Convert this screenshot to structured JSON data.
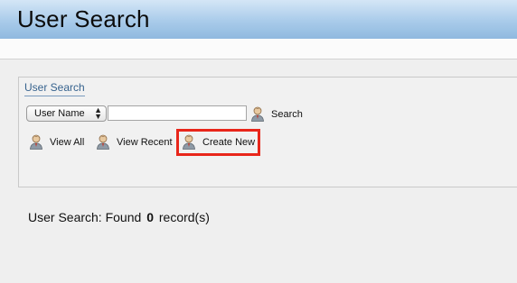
{
  "header": {
    "title": "User Search"
  },
  "panel": {
    "title": "User Search",
    "field_select": {
      "selected": "User Name",
      "arrow_icon": "updown-arrows-icon"
    },
    "search_input": {
      "value": ""
    },
    "search_action": {
      "label": "Search",
      "icon": "user-icon"
    },
    "actions": [
      {
        "label": "View All",
        "icon": "user-icon"
      },
      {
        "label": "View Recent",
        "icon": "user-icon"
      },
      {
        "label": "Create New",
        "icon": "user-icon",
        "highlighted": true
      }
    ]
  },
  "results": {
    "prefix": "User Search: Found",
    "count": "0",
    "suffix": "record(s)"
  },
  "colors": {
    "header_top": "#d4e6f6",
    "header_bottom": "#8fb9df",
    "panel_title": "#37638e",
    "highlight_border": "#e8261a"
  }
}
